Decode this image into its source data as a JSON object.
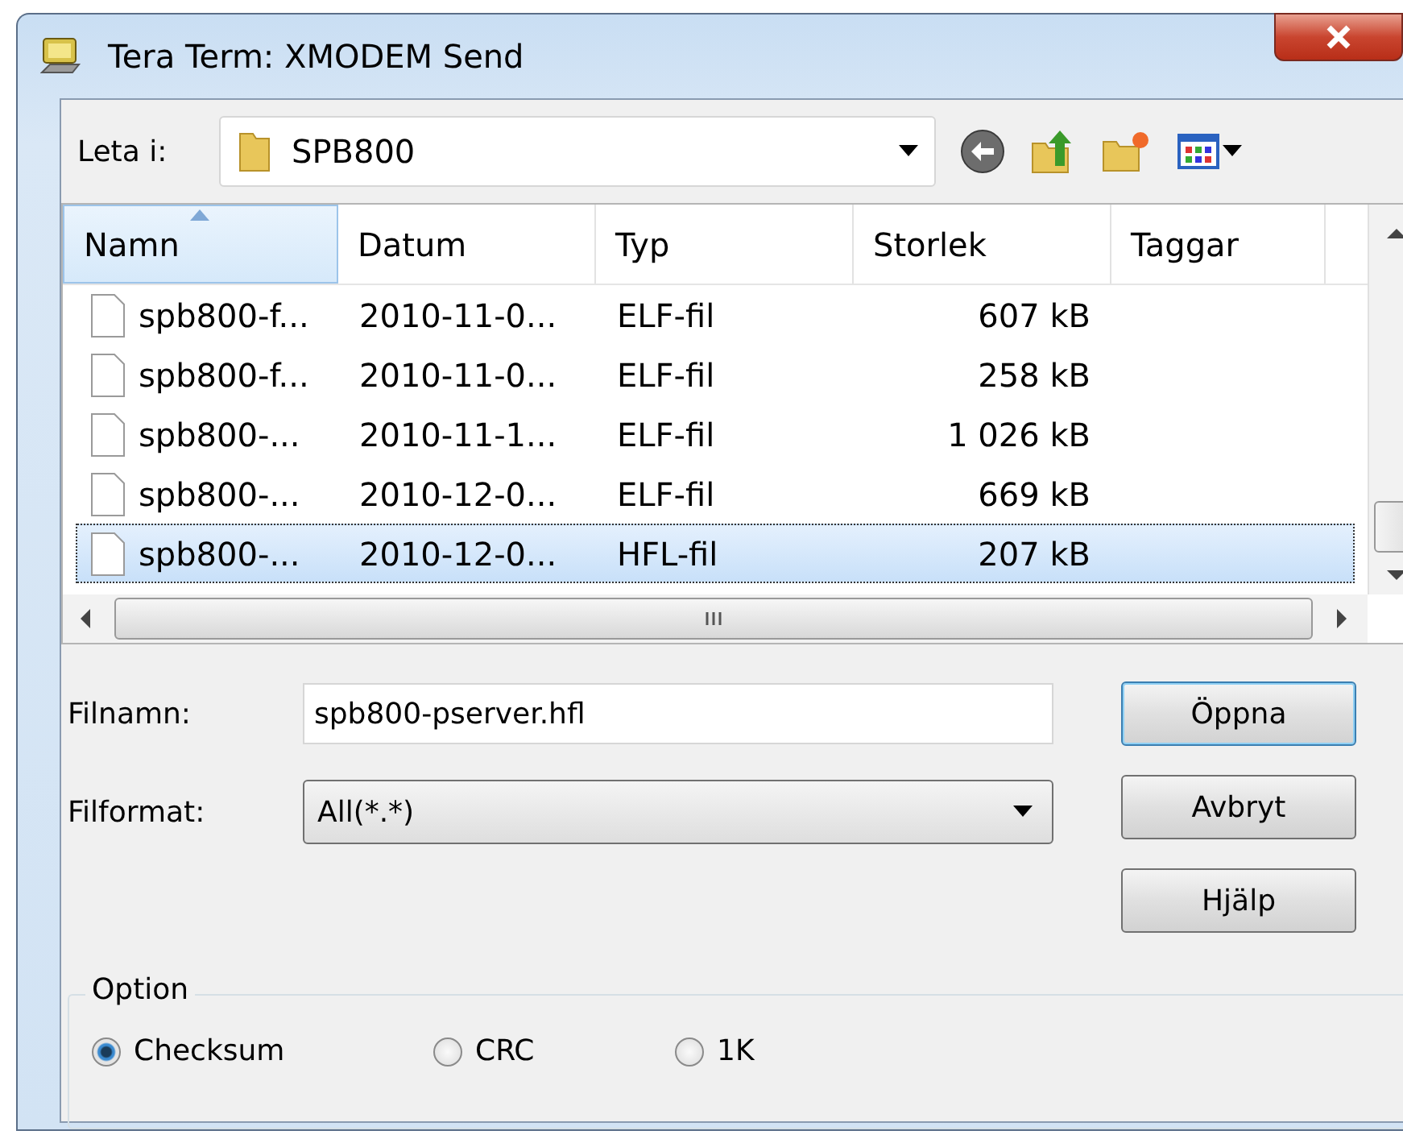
{
  "window": {
    "title": "Tera Term: XMODEM Send"
  },
  "look_in": {
    "label": "Leta i:",
    "value": "SPB800"
  },
  "columns": [
    {
      "label": "Namn",
      "sorted": true
    },
    {
      "label": "Datum",
      "sorted": false
    },
    {
      "label": "Typ",
      "sorted": false
    },
    {
      "label": "Storlek",
      "sorted": false
    },
    {
      "label": "Taggar",
      "sorted": false
    }
  ],
  "rows": [
    {
      "name": "spb800-f...",
      "date": "2010-11-0...",
      "type": "ELF-fil",
      "size": "607 kB",
      "selected": false
    },
    {
      "name": "spb800-f...",
      "date": "2010-11-0...",
      "type": "ELF-fil",
      "size": "258 kB",
      "selected": false
    },
    {
      "name": "spb800-...",
      "date": "2010-11-1...",
      "type": "ELF-fil",
      "size": "1 026 kB",
      "selected": false
    },
    {
      "name": "spb800-...",
      "date": "2010-12-0...",
      "type": "ELF-fil",
      "size": "669 kB",
      "selected": false
    },
    {
      "name": "spb800-...",
      "date": "2010-12-0...",
      "type": "HFL-fil",
      "size": "207 kB",
      "selected": true
    }
  ],
  "filename": {
    "label": "Filnamn:",
    "value": "spb800-pserver.hfl"
  },
  "format": {
    "label": "Filformat:",
    "value": "All(*.*)"
  },
  "buttons": [
    {
      "label": "Öppna",
      "default": true
    },
    {
      "label": "Avbryt",
      "default": false
    },
    {
      "label": "Hjälp",
      "default": false
    }
  ],
  "option": {
    "legend": "Option",
    "radios": [
      {
        "label": "Checksum",
        "selected": true
      },
      {
        "label": "CRC",
        "selected": false
      },
      {
        "label": "1K",
        "selected": false
      }
    ]
  }
}
